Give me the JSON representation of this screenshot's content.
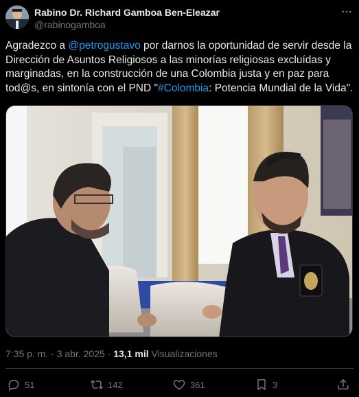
{
  "author": {
    "name": "Rabino Dr. Richard Gamboa Ben-Eleazar",
    "handle": "@rabinogamboa"
  },
  "icons": {
    "more": "more-horizontal-icon",
    "reply": "reply-icon",
    "retweet": "retweet-icon",
    "like": "heart-icon",
    "bookmark": "bookmark-icon",
    "share": "share-icon"
  },
  "tweet": {
    "text_1": "Agradezco a ",
    "mention": "@petrogustavo",
    "text_2": " por darnos la oportunidad de servir desde la Dirección de Asuntos Religiosos a las minorías religiosas excluídas y marginadas, en la construcción de una Colombia justa y en paz para tod@s, en sintonía con el PND \"",
    "hashtag": "#Colombia",
    "text_3": ": Potencia Mundial de la Vida\"."
  },
  "meta": {
    "time": "7:35 p. m.",
    "separator_1": " · ",
    "date": "3 abr. 2025",
    "separator_2": " · ",
    "views_count": "13,1 mil",
    "views_label": " Visualizaciones"
  },
  "actions": {
    "replies": "51",
    "retweets": "142",
    "likes": "361",
    "bookmarks": "3"
  },
  "colors": {
    "background": "#000000",
    "text": "#e7e9ea",
    "muted": "#71767b",
    "link": "#1d9bf0",
    "border": "#2f3336"
  }
}
